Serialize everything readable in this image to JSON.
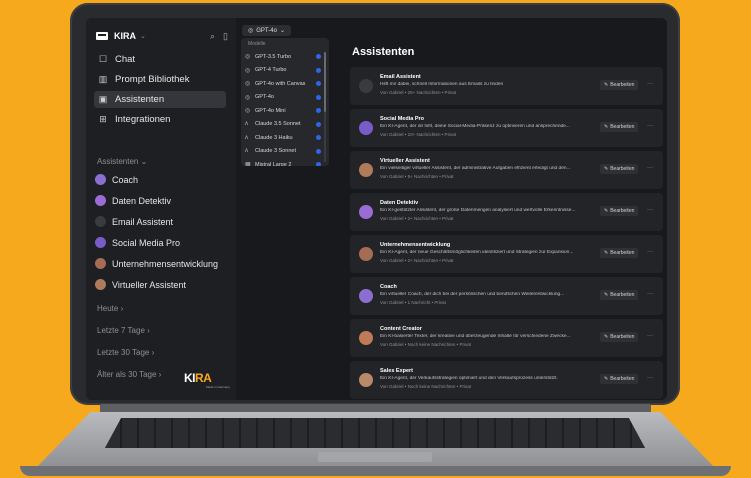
{
  "app": {
    "name": "KIRA"
  },
  "nav": [
    {
      "label": "Chat",
      "icon": "chat-icon",
      "active": false
    },
    {
      "label": "Prompt Bibliothek",
      "icon": "book-icon",
      "active": false
    },
    {
      "label": "Assistenten",
      "icon": "assistant-icon",
      "active": true
    },
    {
      "label": "Integrationen",
      "icon": "integrations-icon",
      "active": false
    }
  ],
  "sidebar_section": "Assistenten",
  "sidebar_assistants": [
    {
      "label": "Coach",
      "color": "#8a6fd0"
    },
    {
      "label": "Daten Detektiv",
      "color": "#9b6bd6"
    },
    {
      "label": "Email Assistent",
      "color": "#3a3b3f"
    },
    {
      "label": "Social Media Pro",
      "color": "#7a5cc9"
    },
    {
      "label": "Unternehmensentwicklung",
      "color": "#a66b55"
    },
    {
      "label": "Virtueller Assistent",
      "color": "#b07b5a"
    }
  ],
  "history": [
    "Heute",
    "Letzte 7 Tage",
    "Letzte 30 Tage",
    "Älter als 30 Tage"
  ],
  "brand": {
    "main": "KI",
    "accent": "RA",
    "sub": "Made in Germany"
  },
  "model_selector": {
    "selected": "GPT-4o",
    "panel_title": "Modelle"
  },
  "models": [
    {
      "label": "GPT-3.5 Turbo",
      "icon": "openai-icon"
    },
    {
      "label": "GPT-4 Turbo",
      "icon": "openai-icon"
    },
    {
      "label": "GPT-4o with Canvas",
      "icon": "openai-icon"
    },
    {
      "label": "GPT-4o",
      "icon": "openai-icon"
    },
    {
      "label": "GPT-4o Mini",
      "icon": "openai-icon"
    },
    {
      "label": "Claude 3.5 Sonnet",
      "icon": "anthropic-icon"
    },
    {
      "label": "Claude 3 Haiku",
      "icon": "anthropic-icon"
    },
    {
      "label": "Claude 3 Sonnet",
      "icon": "anthropic-icon"
    },
    {
      "label": "Mistral Large 2",
      "icon": "mistral-icon"
    }
  ],
  "main": {
    "title": "Assistenten",
    "edit_label": "Bearbeiten"
  },
  "cards": [
    {
      "name": "Email Assistent",
      "desc": "Hilft mir dabei, schnell Informationen aus Emails zu finden",
      "meta": "Von Gabriel • 26+ Nachrichten • Privat",
      "color": "#3a3b3f"
    },
    {
      "name": "Social Media Pro",
      "desc": "Ein KI-Agent, der dir hilft, deine Social-Media-Präsenz zu optimieren und ansprechende...",
      "meta": "Von Gabriel • 10+ Nachrichten • Privat",
      "color": "#7a5cc9"
    },
    {
      "name": "Virtueller Assistent",
      "desc": "Ein vielseitiger virtueller Assistent, der administrative Aufgaben effizient erledigt und den...",
      "meta": "Von Gabriel • 5+ Nachrichten • Privat",
      "color": "#b07b5a"
    },
    {
      "name": "Daten Detektiv",
      "desc": "Ein KI-gestützter Assistent, der große Datenmengen analysiert und wertvolle Erkenntnisse...",
      "meta": "Von Gabriel • 2+ Nachrichten • Privat",
      "color": "#9b6bd6"
    },
    {
      "name": "Unternehmensentwicklung",
      "desc": "Ein KI-Agent, der neue Geschäftsmöglichkeiten identifiziert und Strategien zur Expansion...",
      "meta": "Von Gabriel • 2+ Nachrichten • Privat",
      "color": "#a66b55"
    },
    {
      "name": "Coach",
      "desc": "Ein virtueller Coach, der dich bei der persönlichen und beruflichen Weiterentwicklung...",
      "meta": "Von Gabriel • 1 Nachricht • Privat",
      "color": "#8a6fd0"
    },
    {
      "name": "Content Creator",
      "desc": "Ein KI-basierter Texter, der kreative und überzeugende Inhalte für verschiedene Zwecke...",
      "meta": "Von Gabriel • Noch keine Nachrichten • Privat",
      "color": "#c07a55"
    },
    {
      "name": "Sales Expert",
      "desc": "Ein KI-Agent, der Verkaufsstrategien optimiert und den Verkaufsprozess unterstützt.",
      "meta": "Von Gabriel • Noch keine Nachrichten • Privat",
      "color": "#b88a6a"
    }
  ]
}
